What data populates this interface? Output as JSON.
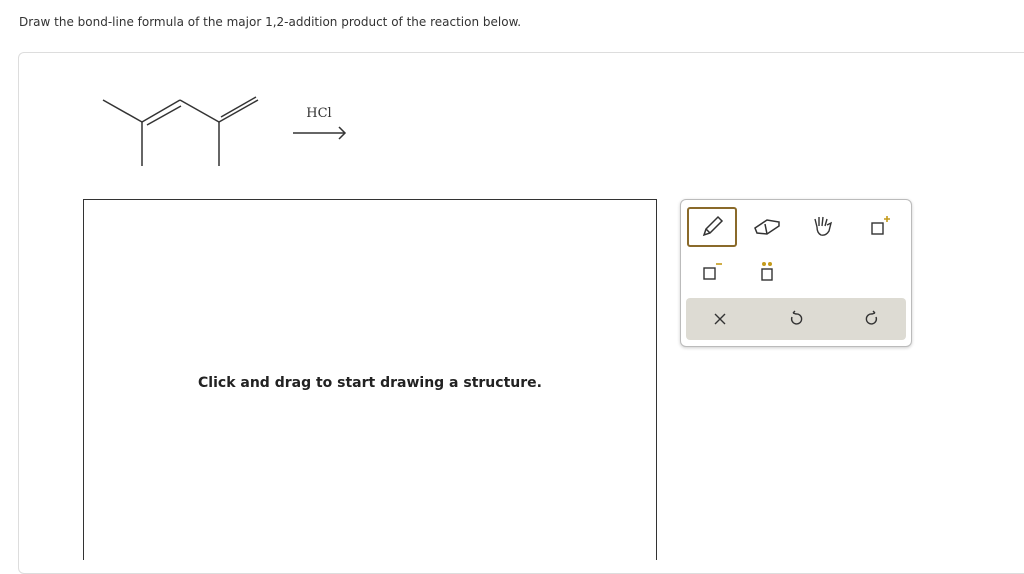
{
  "question": "Draw the bond-line formula of the major 1,2-addition product of the reaction below.",
  "reagent": "HCl",
  "canvas_hint": "Click and drag to start drawing a structure.",
  "toolbar": {
    "tools": [
      "pencil-icon",
      "eraser-icon",
      "hand-icon",
      "increase-charge-icon",
      "decrease-charge-icon",
      "lone-pair-icon"
    ],
    "actions": [
      "clear-icon",
      "undo-icon",
      "redo-icon"
    ],
    "accent": "#8a6a2a"
  }
}
